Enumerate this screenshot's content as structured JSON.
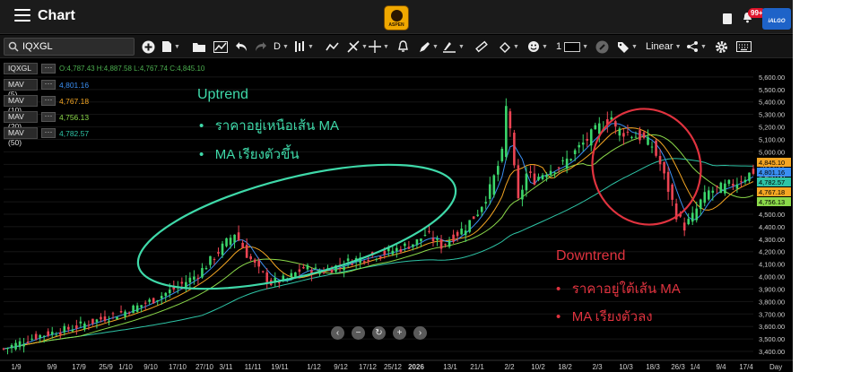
{
  "app": {
    "title": "Chart",
    "logo_text": "ASPEN",
    "notification_count": "99+",
    "brand_badge": "iALGO"
  },
  "toolbar": {
    "search_value": "IQXGL",
    "interval": "D",
    "line_width": "1",
    "scale": "Linear"
  },
  "indicators": {
    "symbol": "IQXGL",
    "ohlc": "O:4,787.43 H:4,887.58 L:4,767.74 C:4,845.10",
    "items": [
      {
        "name": "MAV (5)",
        "value": "4,801.16",
        "color": "#3b8ff3"
      },
      {
        "name": "MAV (10)",
        "value": "4,767.18",
        "color": "#f5a623"
      },
      {
        "name": "MAV (20)",
        "value": "4,756.13",
        "color": "#8bd94a"
      },
      {
        "name": "MAV (50)",
        "value": "4,782.57",
        "color": "#2ec4a6"
      }
    ]
  },
  "annotations": {
    "uptrend": {
      "title": "Uptrend",
      "bullets": [
        "ราคาอยู่เหนือเส้น MA",
        "MA เรียงตัวขึ้น"
      ],
      "color": "#3fd9a9"
    },
    "downtrend": {
      "title": "Downtrend",
      "bullets": [
        "ราคาอยู่ใต้เส้น MA",
        "MA เรียงตัวลง"
      ],
      "color": "#e0333f"
    }
  },
  "colors": {
    "up": "#3bd66b",
    "down": "#ec4453",
    "background": "#000000"
  },
  "chart_data": {
    "type": "candlestick",
    "ylim": [
      3350,
      5700
    ],
    "yticks": [
      3400,
      3500,
      3600,
      3700,
      3800,
      3900,
      4000,
      4100,
      4200,
      4300,
      4400,
      4500,
      4600,
      4700,
      4800,
      4900,
      5000,
      5100,
      5200,
      5300,
      5400,
      5500,
      5600
    ],
    "ytick_labels": [
      "3,400.00",
      "3,500.00",
      "3,600.00",
      "3,700.00",
      "3,800.00",
      "3,900.00",
      "4,000.00",
      "4,100.00",
      "4,200.00",
      "4,300.00",
      "4,400.00",
      "4,500.00",
      "4,600.00",
      "4,700.00",
      "4,800.00",
      "4,900.00",
      "5,000.00",
      "5,100.00",
      "5,200.00",
      "5,300.00",
      "5,400.00",
      "5,500.00",
      "5,600.00"
    ],
    "x_labels": [
      "1/9",
      "9/9",
      "17/9",
      "25/9",
      "1/10",
      "9/10",
      "17/10",
      "27/10",
      "3/11",
      "11/11",
      "19/11",
      "1/12",
      "9/12",
      "17/12",
      "25/12",
      "2026",
      "13/1",
      "21/1",
      "2/2",
      "10/2",
      "18/2",
      "2/3",
      "10/3",
      "18/3",
      "26/3",
      "1/4",
      "9/4",
      "17/4"
    ],
    "x_unit": "Day",
    "last_price_labels": [
      {
        "text": "4,845.10",
        "color": "#f5a623"
      },
      {
        "text": "4,801.16",
        "color": "#3b8ff3"
      },
      {
        "text": "4,782.57",
        "color": "#2ec4a6"
      },
      {
        "text": "4,767.18",
        "color": "#f5a623"
      },
      {
        "text": "4,756.13",
        "color": "#8bd94a"
      }
    ],
    "close_path": [
      [
        0,
        3420
      ],
      [
        8,
        3520
      ],
      [
        16,
        3580
      ],
      [
        24,
        3660
      ],
      [
        30,
        3720
      ],
      [
        36,
        3800
      ],
      [
        42,
        3900
      ],
      [
        48,
        4020
      ],
      [
        53,
        4200
      ],
      [
        57,
        4350
      ],
      [
        60,
        4180
      ],
      [
        63,
        4050
      ],
      [
        66,
        3950
      ],
      [
        70,
        3980
      ],
      [
        74,
        4070
      ],
      [
        78,
        4040
      ],
      [
        82,
        4080
      ],
      [
        86,
        4130
      ],
      [
        90,
        4160
      ],
      [
        94,
        4190
      ],
      [
        98,
        4230
      ],
      [
        102,
        4280
      ],
      [
        104,
        4340
      ],
      [
        106,
        4300
      ],
      [
        108,
        4250
      ],
      [
        111,
        4320
      ],
      [
        114,
        4400
      ],
      [
        117,
        4520
      ],
      [
        120,
        4700
      ],
      [
        123,
        4980
      ],
      [
        124,
        5350
      ],
      [
        125,
        5200
      ],
      [
        126,
        4850
      ],
      [
        127,
        4600
      ],
      [
        129,
        4820
      ],
      [
        131,
        4780
      ],
      [
        134,
        4850
      ],
      [
        138,
        4900
      ],
      [
        141,
        5000
      ],
      [
        144,
        5100
      ],
      [
        147,
        5200
      ],
      [
        150,
        5280
      ],
      [
        151,
        5180
      ],
      [
        154,
        5150
      ],
      [
        157,
        5120
      ],
      [
        160,
        5050
      ],
      [
        162,
        4900
      ],
      [
        164,
        4700
      ],
      [
        166,
        4500
      ],
      [
        168,
        4400
      ],
      [
        170,
        4480
      ],
      [
        172,
        4600
      ],
      [
        174,
        4680
      ],
      [
        176,
        4700
      ],
      [
        178,
        4720
      ],
      [
        181,
        4760
      ],
      [
        183,
        4800
      ],
      [
        185,
        4845.1
      ]
    ]
  }
}
